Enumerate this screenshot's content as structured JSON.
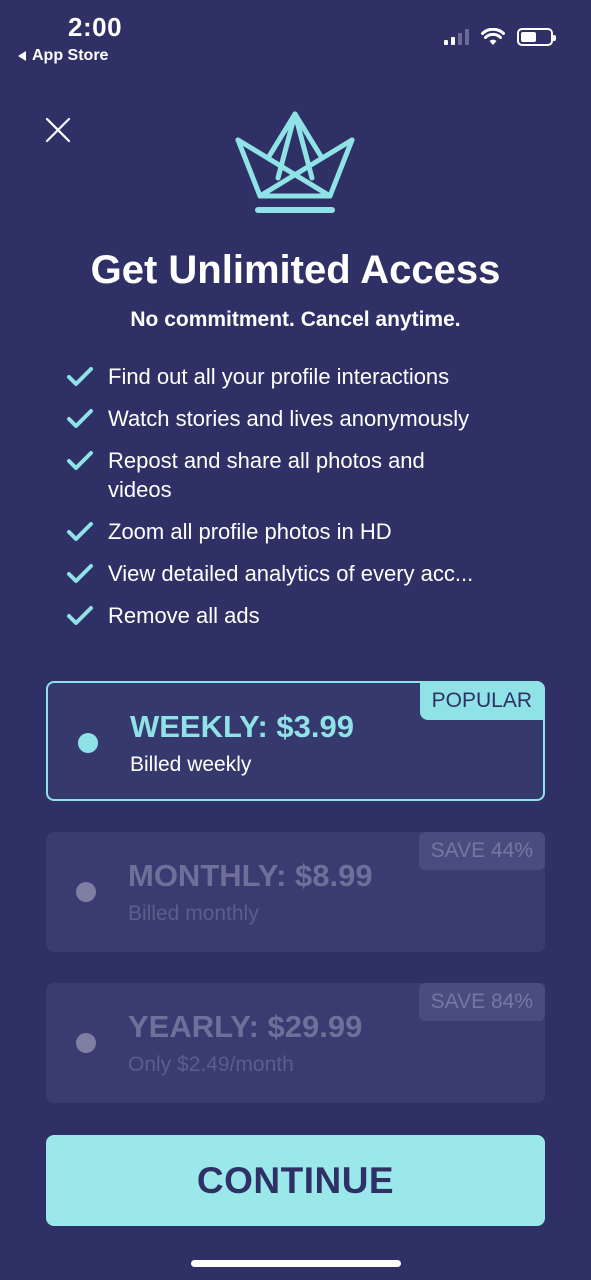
{
  "status_bar": {
    "time": "2:00",
    "back_label": "App Store"
  },
  "header": {
    "title": "Get Unlimited Access",
    "subtitle": "No commitment. Cancel anytime."
  },
  "features": [
    "Find out all your profile interactions",
    "Watch stories and lives anonymously",
    "Repost and share all photos and videos",
    "Zoom all profile photos in HD",
    "View detailed analytics of every acc...",
    "Remove all ads"
  ],
  "plans": [
    {
      "name": "WEEKLY: $3.99",
      "desc": "Billed weekly",
      "badge": "POPULAR",
      "selected": true
    },
    {
      "name": "MONTHLY: $8.99",
      "desc": "Billed monthly",
      "badge": "SAVE 44%",
      "selected": false
    },
    {
      "name": "YEARLY: $29.99",
      "desc": "Only $2.49/month",
      "badge": "SAVE 84%",
      "selected": false
    }
  ],
  "continue_label": "CONTINUE",
  "colors": {
    "background": "#2f3166",
    "accent": "#8fe3e6",
    "button": "#9ae8ea"
  },
  "icons": {
    "close": "close-icon",
    "crown": "crown-icon",
    "check": "check-icon"
  }
}
